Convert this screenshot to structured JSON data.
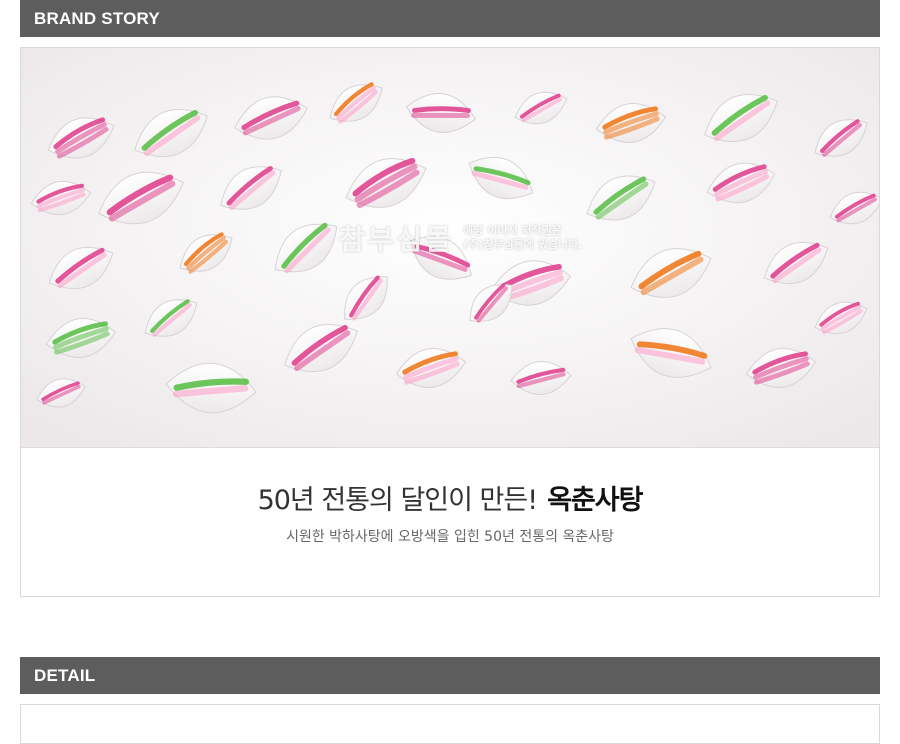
{
  "sections": {
    "brand_story": {
      "title": "BRAND STORY"
    },
    "detail": {
      "title": "DETAIL"
    }
  },
  "brand": {
    "headline_light": "50년 전통의 달인이 만든!",
    "headline_bold": "옥춘사탕",
    "subtitle": "시원한 박하사탕에 오방색을 입힌 50년 전통의 옥춘사탕",
    "photo_subject": "candy-photo",
    "watermark": {
      "name": "참부심몰",
      "note_line1": "해당 이미지 저작권은",
      "note_line2": "(주)참부심몰에 있습니다."
    }
  },
  "colors": {
    "section_bar": "#5d5d5d",
    "candy_pink": "#e0448f",
    "candy_green": "#5cc04a",
    "candy_orange": "#f07a1f"
  }
}
